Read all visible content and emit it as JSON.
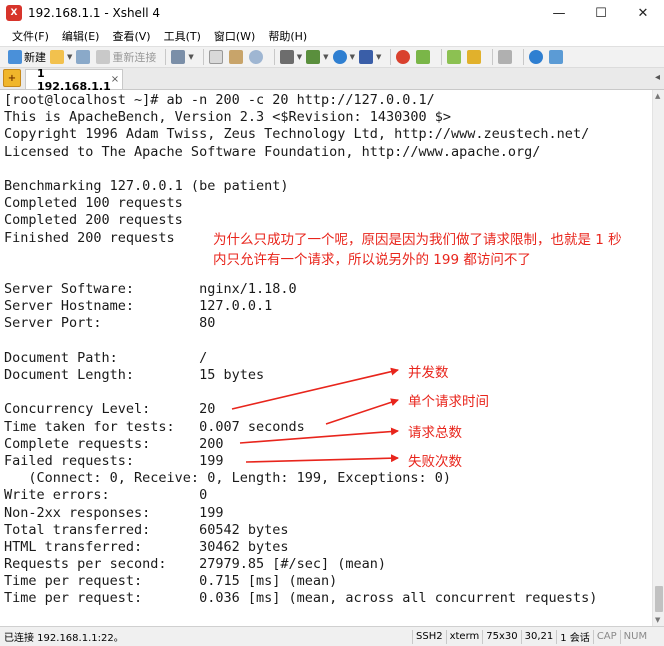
{
  "window": {
    "title": "192.168.1.1 - Xshell 4",
    "controls": {
      "minimize": "—",
      "maximize": "☐",
      "close": "✕"
    }
  },
  "menu": [
    "文件(F)",
    "编辑(E)",
    "查看(V)",
    "工具(T)",
    "窗口(W)",
    "帮助(H)"
  ],
  "toolbar": {
    "new_label": "新建",
    "reconnect_label": "重新连接",
    "icons": [
      "new-session-icon",
      "open-folder-icon",
      "link-icon",
      "reconnect-icon",
      "properties-icon",
      "copy-icon",
      "paste-icon",
      "find-icon",
      "print-icon",
      "transfer-icon",
      "globe-icon",
      "font-icon",
      "xftp-icon",
      "script-icon",
      "layout-icon",
      "lock-icon",
      "keyboard-icon",
      "help-icon",
      "chat-icon"
    ]
  },
  "tab": {
    "label": "1 192.168.1.1",
    "close": "×"
  },
  "terminal": {
    "lines": [
      "[root@localhost ~]# ab -n 200 -c 20 http://127.0.0.1/",
      "This is ApacheBench, Version 2.3 <$Revision: 1430300 $>",
      "Copyright 1996 Adam Twiss, Zeus Technology Ltd, http://www.zeustech.net/",
      "Licensed to The Apache Software Foundation, http://www.apache.org/",
      "",
      "Benchmarking 127.0.0.1 (be patient)",
      "Completed 100 requests",
      "Completed 200 requests",
      "Finished 200 requests",
      "",
      "",
      "Server Software:        nginx/1.18.0",
      "Server Hostname:        127.0.0.1",
      "Server Port:            80",
      "",
      "Document Path:          /",
      "Document Length:        15 bytes",
      "",
      "Concurrency Level:      20",
      "Time taken for tests:   0.007 seconds",
      "Complete requests:      200",
      "Failed requests:        199",
      "   (Connect: 0, Receive: 0, Length: 199, Exceptions: 0)",
      "Write errors:           0",
      "Non-2xx responses:      199",
      "Total transferred:      60542 bytes",
      "HTML transferred:       30462 bytes",
      "Requests per second:    27979.85 [#/sec] (mean)",
      "Time per request:       0.715 [ms] (mean)",
      "Time per request:       0.036 [ms] (mean, across all concurrent requests)"
    ]
  },
  "annotations": {
    "note_line1": "为什么只成功了一个呢，原因是因为我们做了请求限制，也就是 1 秒",
    "note_line2": "内只允许有一个请求，所以说另外的 199 都访问不了",
    "concurrency": "并发数",
    "time_per_request": "单个请求时间",
    "total_requests": "请求总数",
    "failed_requests": "失败次数",
    "color": "#e8251c"
  },
  "statusbar": {
    "connection": "已连接 192.168.1.1:22。",
    "protocol": "SSH2",
    "terminal_type": "xterm",
    "size": "75x30",
    "cursor": "30,21",
    "sessions": "1 会话",
    "cap": "CAP",
    "num": "NUM"
  }
}
